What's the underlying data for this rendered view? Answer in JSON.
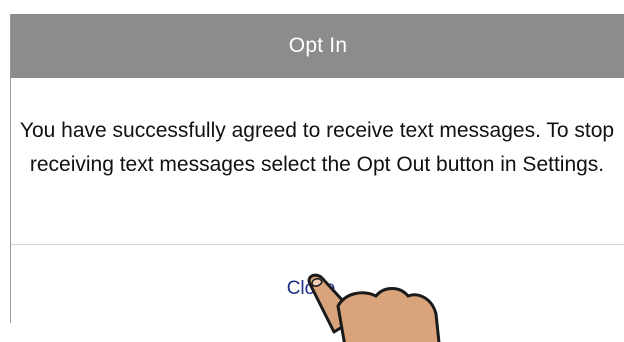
{
  "dialog": {
    "title": "Opt In",
    "message": "You have successfully agreed to receive text messages. To stop receiving text messages select the Opt Out button in Settings.",
    "close_label": "Close"
  },
  "colors": {
    "header_background": "#8c8c8c",
    "header_text": "#ffffff",
    "message_text": "#111111",
    "close_link": "#1f2f86",
    "hand_skin": "#d9a37c"
  },
  "icons": {
    "pointer": "hand-pointer-icon"
  }
}
